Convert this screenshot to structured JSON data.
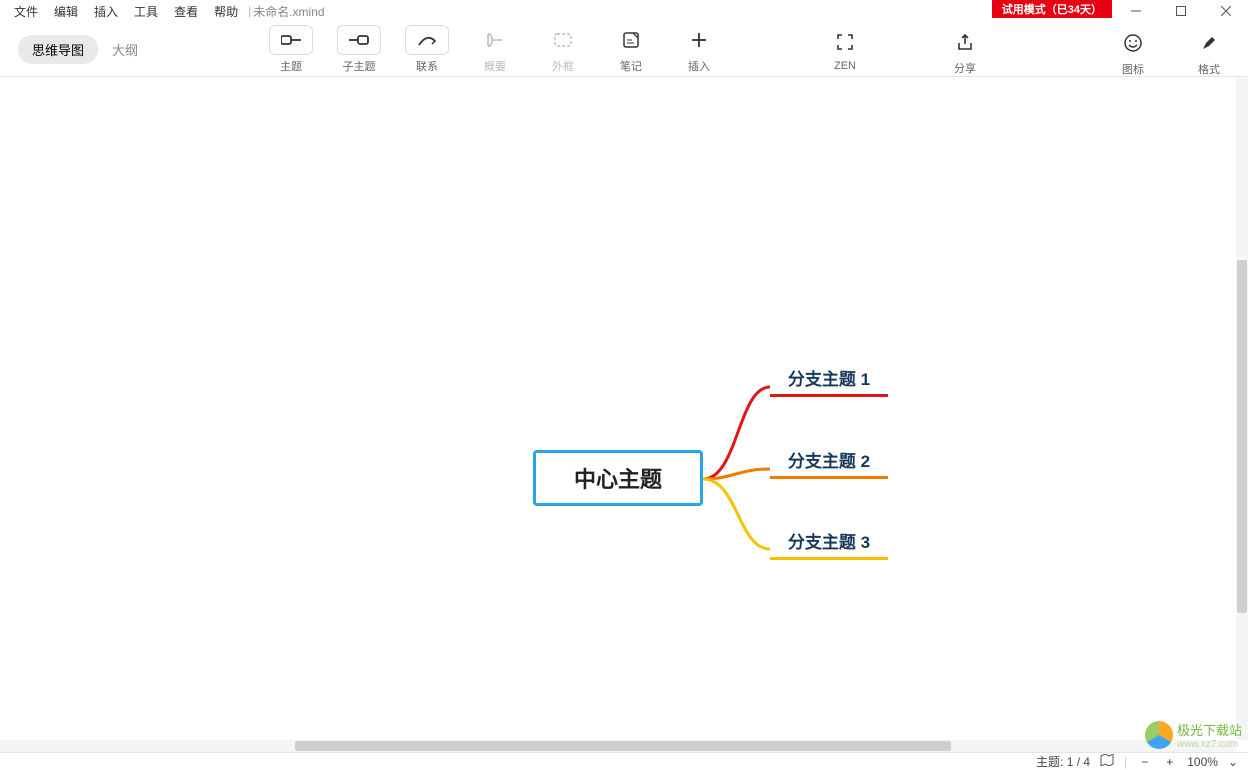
{
  "menu": {
    "file": "文件",
    "edit": "编辑",
    "insert": "插入",
    "tools": "工具",
    "view": "查看",
    "help": "帮助",
    "filename": "未命名.xmind",
    "trial": "试用模式（已34天）"
  },
  "view_switch": {
    "mindmap": "思维导图",
    "outline": "大纲"
  },
  "toolbar": {
    "topic": "主题",
    "subtopic": "子主题",
    "relation": "联系",
    "summary": "概要",
    "boundary": "外框",
    "notes": "笔记",
    "insert": "插入",
    "zen": "ZEN",
    "share": "分享",
    "icons": "图标",
    "format": "格式"
  },
  "mindmap": {
    "central": "中心主题",
    "branches": [
      "分支主题 1",
      "分支主题 2",
      "分支主题 3"
    ]
  },
  "status": {
    "topic_count": "主题: 1 / 4",
    "zoom": "100%"
  },
  "watermark": {
    "name": "极光下载站",
    "url": "www.xz7.com"
  },
  "colors": {
    "central_border": "#2aa3e8",
    "branch1": "#e01515",
    "branch2": "#f07c00",
    "branch3": "#f7c100"
  }
}
